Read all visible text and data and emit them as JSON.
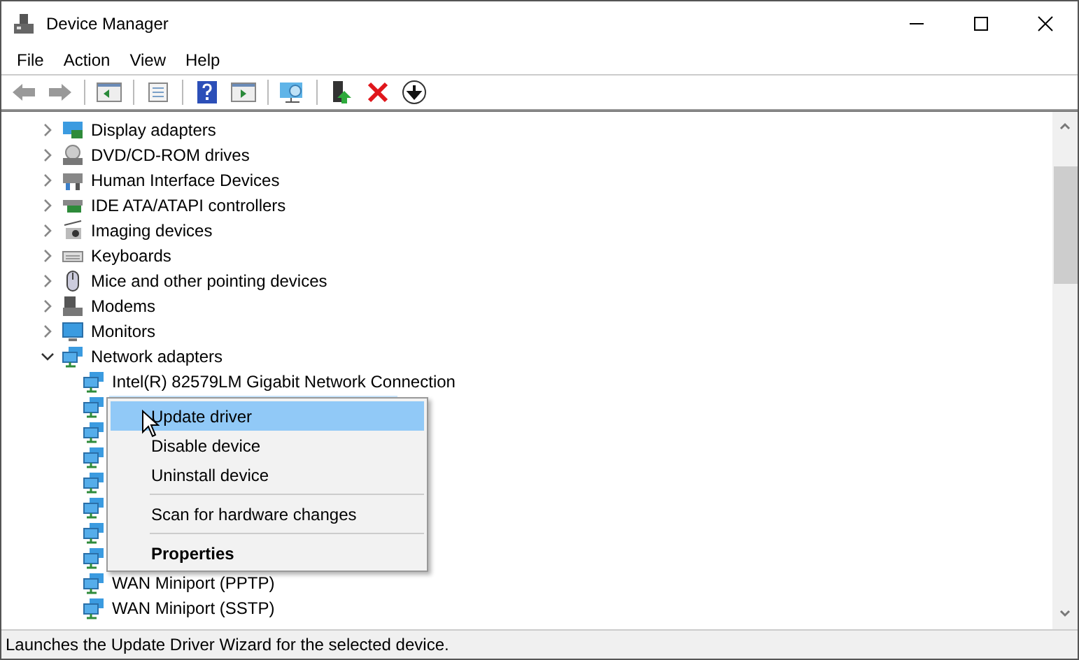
{
  "window": {
    "title": "Device Manager"
  },
  "menu_bar": [
    "File",
    "Action",
    "View",
    "Help"
  ],
  "tree": [
    {
      "label": "Display adapters",
      "expanded": false
    },
    {
      "label": "DVD/CD-ROM drives",
      "expanded": false
    },
    {
      "label": "Human Interface Devices",
      "expanded": false
    },
    {
      "label": "IDE ATA/ATAPI controllers",
      "expanded": false
    },
    {
      "label": "Imaging devices",
      "expanded": false
    },
    {
      "label": "Keyboards",
      "expanded": false
    },
    {
      "label": "Mice and other pointing devices",
      "expanded": false
    },
    {
      "label": "Modems",
      "expanded": false
    },
    {
      "label": "Monitors",
      "expanded": false
    },
    {
      "label": "Network adapters",
      "expanded": true,
      "children": [
        {
          "label": "Intel(R) 82579LM Gigabit Network Connection",
          "selected": false
        },
        {
          "selected": true
        },
        {
          "selected": false
        },
        {
          "selected": false
        },
        {
          "selected": false
        },
        {
          "selected": false
        },
        {
          "selected": false
        },
        {
          "selected": false
        },
        {
          "label": "WAN Miniport (PPTP)",
          "selected": false
        },
        {
          "label": "WAN Miniport (SSTP)",
          "selected": false
        }
      ]
    }
  ],
  "context_menu": [
    {
      "kind": "item",
      "label": "Update driver",
      "selected": true,
      "default": false
    },
    {
      "kind": "item",
      "label": "Disable device",
      "selected": false,
      "default": false
    },
    {
      "kind": "item",
      "label": "Uninstall device",
      "selected": false,
      "default": false
    },
    {
      "kind": "separator"
    },
    {
      "kind": "item",
      "label": "Scan for hardware changes",
      "selected": false,
      "default": false
    },
    {
      "kind": "separator"
    },
    {
      "kind": "item",
      "label": "Properties",
      "selected": false,
      "default": true
    }
  ],
  "status_bar": "Launches the Update Driver Wizard for the selected device."
}
